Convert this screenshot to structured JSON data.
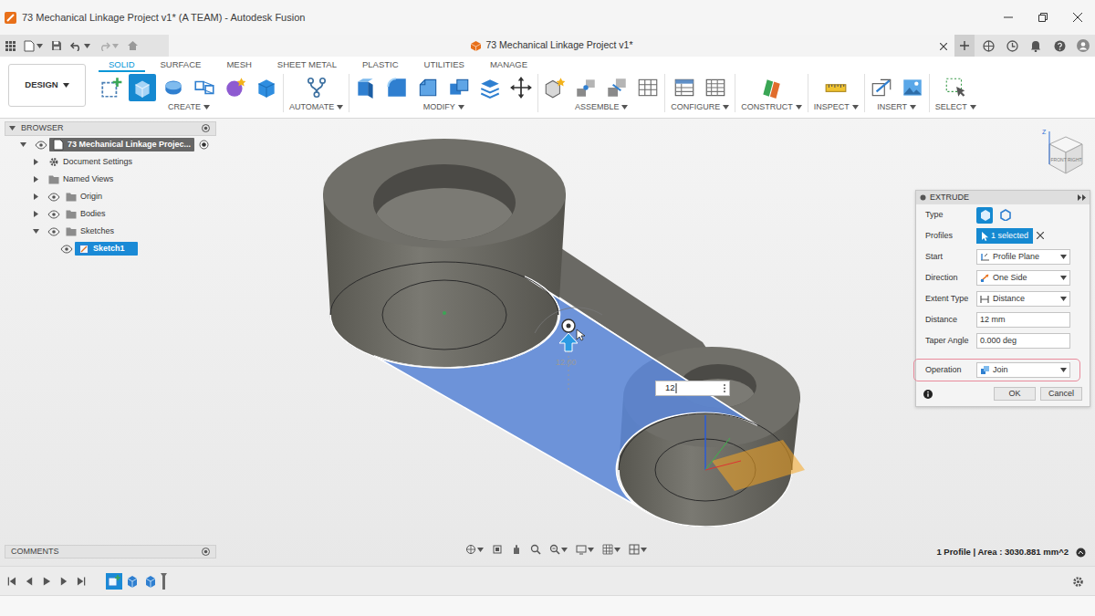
{
  "window": {
    "title": "73 Mechanical Linkage Project v1* (A TEAM) - Autodesk Fusion"
  },
  "document_tab": {
    "label": "73 Mechanical Linkage Project v1*",
    "selected": true
  },
  "workspace": {
    "label": "DESIGN"
  },
  "ribbon_tabs": [
    {
      "label": "SOLID",
      "selected": true
    },
    {
      "label": "SURFACE",
      "selected": false
    },
    {
      "label": "MESH",
      "selected": false
    },
    {
      "label": "SHEET METAL",
      "selected": false
    },
    {
      "label": "PLASTIC",
      "selected": false
    },
    {
      "label": "UTILITIES",
      "selected": false
    },
    {
      "label": "MANAGE",
      "selected": false
    }
  ],
  "ribbon_groups": [
    {
      "label": "CREATE",
      "tools": [
        {
          "kind": "sketch",
          "selected": false
        },
        {
          "kind": "extrude",
          "selected": true
        },
        {
          "kind": "revolve",
          "selected": false
        },
        {
          "kind": "project",
          "selected": false
        },
        {
          "kind": "form",
          "selected": false
        },
        {
          "kind": "box",
          "selected": false
        }
      ]
    },
    {
      "label": "AUTOMATE",
      "tools": [
        {
          "kind": "automate",
          "selected": false
        }
      ]
    },
    {
      "label": "MODIFY",
      "tools": [
        {
          "kind": "presspull",
          "selected": false
        },
        {
          "kind": "fillet",
          "selected": false
        },
        {
          "kind": "chamfer",
          "selected": false
        },
        {
          "kind": "combine",
          "selected": false
        },
        {
          "kind": "align",
          "selected": false
        },
        {
          "kind": "move",
          "selected": false
        }
      ]
    },
    {
      "label": "ASSEMBLE",
      "tools": [
        {
          "kind": "component",
          "selected": false
        },
        {
          "kind": "joint",
          "selected": false
        },
        {
          "kind": "asbuilt",
          "selected": false
        },
        {
          "kind": "table",
          "selected": false
        }
      ]
    },
    {
      "label": "CONFIGURE",
      "tools": [
        {
          "kind": "configure",
          "selected": false
        },
        {
          "kind": "sheet",
          "selected": false
        }
      ]
    },
    {
      "label": "CONSTRUCT",
      "tools": [
        {
          "kind": "plane",
          "selected": false
        }
      ]
    },
    {
      "label": "INSPECT",
      "tools": [
        {
          "kind": "measure",
          "selected": false
        }
      ]
    },
    {
      "label": "INSERT",
      "tools": [
        {
          "kind": "insert",
          "selected": false
        },
        {
          "kind": "decal",
          "selected": false
        }
      ]
    },
    {
      "label": "SELECT",
      "tools": [
        {
          "kind": "select",
          "selected": false
        }
      ]
    }
  ],
  "browser": {
    "title": "BROWSER",
    "items": [
      {
        "label": "73 Mechanical Linkage Projec...",
        "kind": "root",
        "expanded": true,
        "visible": true,
        "active": true,
        "selected": false,
        "children": [
          {
            "label": "Document Settings",
            "kind": "settings",
            "expanded": false,
            "selected": false
          },
          {
            "label": "Named Views",
            "kind": "folder",
            "expanded": false,
            "selected": false
          },
          {
            "label": "Origin",
            "kind": "folder",
            "expanded": false,
            "visible": true,
            "selected": false
          },
          {
            "label": "Bodies",
            "kind": "folder",
            "expanded": false,
            "visible": true,
            "selected": false
          },
          {
            "label": "Sketches",
            "kind": "folder",
            "expanded": true,
            "visible": true,
            "selected": false,
            "children": [
              {
                "label": "Sketch1",
                "kind": "sketch",
                "visible": true,
                "selected": true
              }
            ]
          }
        ]
      }
    ]
  },
  "viewport": {
    "dimension": "12.00",
    "distance_input": "12",
    "status": "1 Profile | Area : 3030.881 mm^2",
    "viewcube": {
      "axis": "Z",
      "front": "FRONT",
      "right": "RIGHT"
    }
  },
  "extrude": {
    "title": "EXTRUDE",
    "rows": [
      {
        "label": "Type",
        "kind": "type",
        "highlighted": false,
        "options": [
          {
            "selected": true
          },
          {
            "selected": false
          }
        ]
      },
      {
        "label": "Profiles",
        "kind": "selection",
        "value": "1 selected",
        "highlighted": false
      },
      {
        "label": "Start",
        "kind": "dropdown",
        "value": "Profile Plane",
        "highlighted": false
      },
      {
        "label": "Direction",
        "kind": "dropdown",
        "value": "One Side",
        "highlighted": false
      },
      {
        "label": "Extent Type",
        "kind": "dropdown",
        "value": "Distance",
        "highlighted": false
      },
      {
        "label": "Distance",
        "kind": "input",
        "value": "12 mm",
        "highlighted": false
      },
      {
        "label": "Taper Angle",
        "kind": "input",
        "value": "0.000 deg",
        "highlighted": false
      },
      {
        "label": "Operation",
        "kind": "dropdown",
        "value": "Join",
        "highlighted": true
      }
    ],
    "buttons": [
      "OK",
      "Cancel"
    ]
  },
  "comments": {
    "title": "COMMENTS"
  },
  "timeline": {
    "items": [
      {
        "kind": "sketch",
        "selected": true
      },
      {
        "kind": "extrude",
        "selected": false
      },
      {
        "kind": "extrude",
        "selected": false
      }
    ]
  }
}
